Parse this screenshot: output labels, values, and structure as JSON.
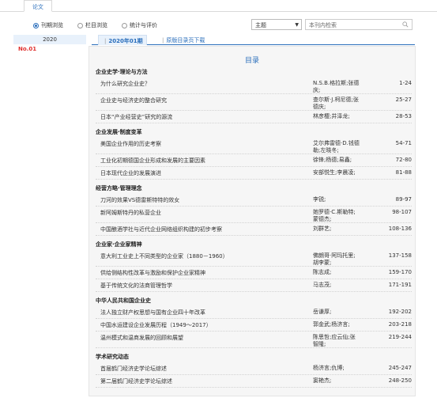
{
  "top_tab": "论文",
  "filters": {
    "radios": [
      {
        "label": "刊期浏览",
        "selected": true
      },
      {
        "label": "栏目浏览",
        "selected": false
      },
      {
        "label": "统计与评价",
        "selected": false
      }
    ],
    "select_value": "主题",
    "search_placeholder": "本刊内检索"
  },
  "sidebar": {
    "year": "2020",
    "issue": "No.01"
  },
  "issue_tabs": {
    "active": "2020年01期",
    "download": "原版目录页下载"
  },
  "toc": {
    "heading": "目录",
    "sections": [
      {
        "name": "企业史学·理论与方法",
        "articles": [
          {
            "title": "为什么研究企业史？",
            "author": "N.S.B.格拉斯;张德庆;",
            "pages": "1-24"
          },
          {
            "title": "企业史与经济史的整合研究",
            "author": "查尔斯·J.柯尼德;张德庆;",
            "pages": "25-27"
          },
          {
            "title": "日本“产业经营史”研究的源流",
            "author": "林彦樱;井泽龙;",
            "pages": "28-53"
          }
        ]
      },
      {
        "name": "企业发展·制度变革",
        "articles": [
          {
            "title": "美国企业作用的历史考察",
            "author": "艾尔弗雷德·D.钱德勒;左晓冬;",
            "pages": "54-71"
          },
          {
            "title": "工业化初期德国企业形成和发展的主要因素",
            "author": "徐锋;杨德;易鑫;",
            "pages": "72-80"
          },
          {
            "title": "日本现代企业的发展演进",
            "author": "安部悦生;李晨凌;",
            "pages": "81-88"
          }
        ]
      },
      {
        "name": "经营方略·管理理念",
        "articles": [
          {
            "title": "刀河的效果VS德雷斯特特的效女",
            "author": "李锐;",
            "pages": "89-97"
          },
          {
            "title": "新阿姆斯特丹的私营企业",
            "author": "她罗德·C.斯勒特;蒙德杰;",
            "pages": "98-107"
          },
          {
            "title": "中国酿酒学社与近代企业网络组织构建的初步考察",
            "author": "刘群艺;",
            "pages": "108-136"
          }
        ]
      },
      {
        "name": "企业家·企业家精神",
        "articles": [
          {
            "title": "意大利工业史上不同类型的企业家（1880－1960）",
            "author": "佛朗哥·阿玛托里;胡李蒙;",
            "pages": "137-158"
          },
          {
            "title": "供给侧结构性改革与激励和保护企业家精神",
            "author": "陈志成;",
            "pages": "159-170"
          },
          {
            "title": "基于传统文化的法商管理哲学",
            "author": "马志茂;",
            "pages": "171-191"
          }
        ]
      },
      {
        "name": "中华人民共和国企业史",
        "articles": [
          {
            "title": "法人独立财产权思想与国有企业四十年改革",
            "author": "岳谦厚;",
            "pages": "192-202"
          },
          {
            "title": "中国水运建设企业发展历程（1949～2017）",
            "author": "郭金武;杨济言;",
            "pages": "203-218"
          },
          {
            "title": "温州模式和温商发展的回顾和展望",
            "author": "陈思哲;应云仙;张智隆;",
            "pages": "219-244"
          }
        ]
      },
      {
        "name": "学术研究动态",
        "articles": [
          {
            "title": "首届鹤门经济史学论坛综述",
            "author": "杨济言;仇博;",
            "pages": "245-247"
          },
          {
            "title": "第二届鹤门经济史学论坛综述",
            "author": "窦艳杰;",
            "pages": "248-250"
          }
        ]
      }
    ]
  }
}
